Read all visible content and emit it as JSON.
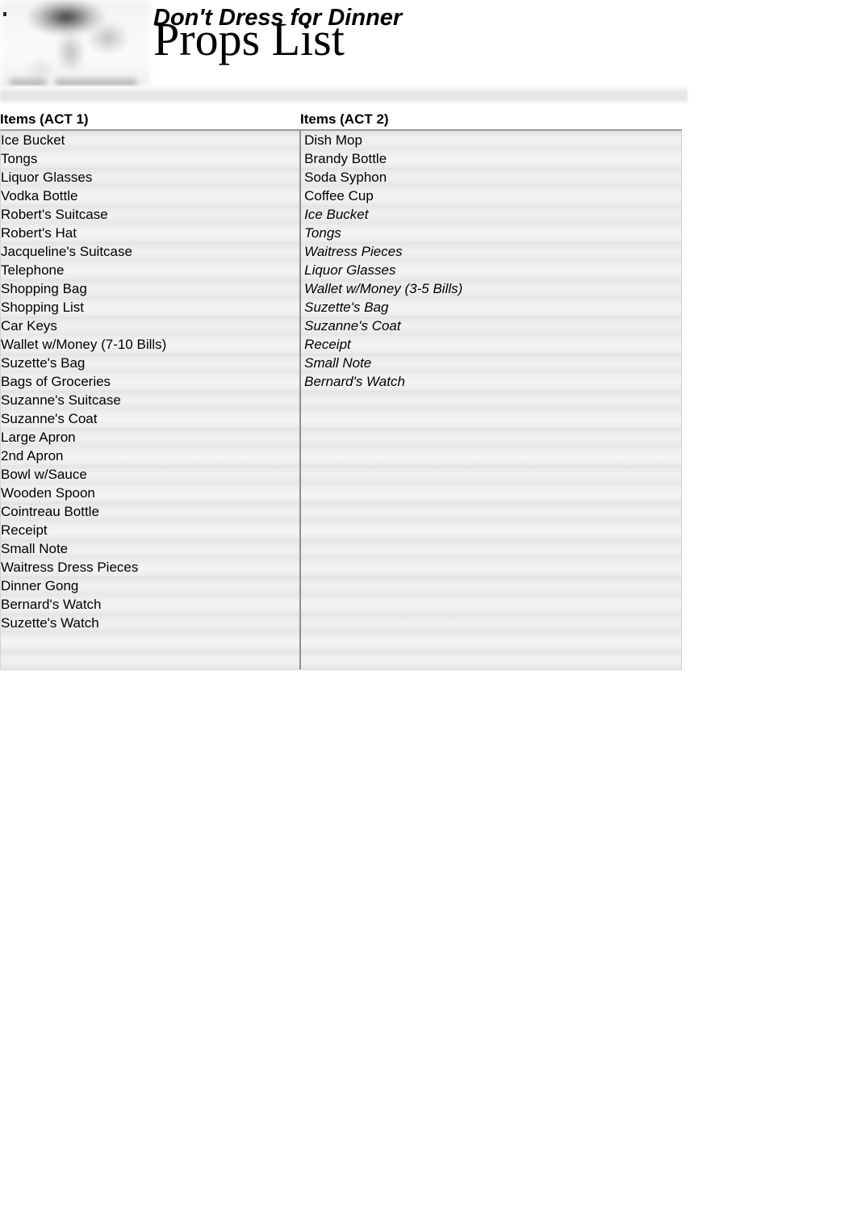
{
  "header": {
    "show_title": "Don't Dress for Dinner",
    "document_title": "Props List",
    "logo_alt": "production-logo"
  },
  "table": {
    "columns": [
      {
        "header": "Items (ACT 1)"
      },
      {
        "header": "Items (ACT 2)"
      }
    ],
    "act1_items": [
      "Ice Bucket",
      "Tongs",
      "Liquor Glasses",
      "Vodka Bottle",
      "Robert's Suitcase",
      "Robert's Hat",
      "Jacqueline's Suitcase",
      "Telephone",
      "Shopping Bag",
      "Shopping List",
      "Car Keys",
      "Wallet w/Money (7-10 Bills)",
      "Suzette's Bag",
      "Bags of Groceries",
      "Suzanne's Suitcase",
      "Suzanne's Coat",
      "Large Apron",
      "2nd Apron",
      "Bowl w/Sauce",
      "Wooden Spoon",
      "Cointreau Bottle",
      "Receipt",
      "Small Note",
      "Waitress Dress Pieces",
      "Dinner Gong",
      "Bernard's Watch",
      "Suzette's Watch",
      "",
      ""
    ],
    "act2_items": [
      "Dish Mop",
      "Brandy Bottle",
      "Soda Syphon",
      "Coffee Cup",
      "Ice Bucket",
      "Tongs",
      "Waitress Pieces",
      "Liquor Glasses",
      "Wallet w/Money (3-5 Bills)",
      "Suzette's Bag",
      "Suzanne's Coat",
      "Receipt",
      "Small Note",
      "Bernard's Watch",
      "",
      "",
      "",
      "",
      "",
      "",
      "",
      "",
      "",
      "",
      "",
      "",
      "",
      "",
      ""
    ],
    "act2_italic_from_index": 4,
    "row_count": 29
  },
  "colors": {
    "text": "#000000",
    "row_light": "#f1f1f1",
    "row_dark": "#e2e2e2",
    "divider": "#8f8f8f",
    "band": "#e3e3e3"
  }
}
